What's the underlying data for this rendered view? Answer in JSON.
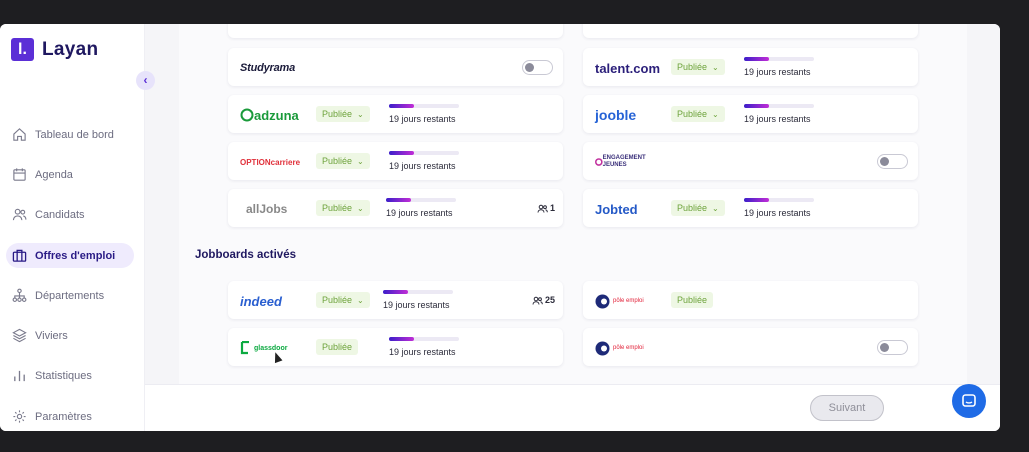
{
  "app": {
    "logo_letter": "l.",
    "name": "Layan",
    "collapse_icon": "chevron-left-icon"
  },
  "sidebar": {
    "items": [
      {
        "label": "Tableau de bord",
        "icon": "home-icon",
        "active": false
      },
      {
        "label": "Agenda",
        "icon": "calendar-icon",
        "active": false
      },
      {
        "label": "Candidats",
        "icon": "users-icon",
        "active": false
      },
      {
        "label": "Offres d'emploi",
        "icon": "briefcase-icon",
        "active": true
      },
      {
        "label": "Départements",
        "icon": "org-chart-icon",
        "active": false
      },
      {
        "label": "Viviers",
        "icon": "layers-icon",
        "active": false
      },
      {
        "label": "Statistiques",
        "icon": "bar-chart-icon",
        "active": false
      },
      {
        "label": "Paramètres",
        "icon": "gear-icon",
        "active": false
      }
    ]
  },
  "boards": {
    "studyrama": {
      "name": "Studyrama",
      "enabled": false
    },
    "talent": {
      "name": "talent.com",
      "status": "Publiée",
      "remaining": "19 jours restants",
      "progress": 0.35
    },
    "adzuna": {
      "name": "adzuna",
      "status": "Publiée",
      "remaining": "19 jours restants",
      "progress": 0.35
    },
    "jooble": {
      "name": "jooble",
      "status": "Publiée",
      "remaining": "19 jours restants",
      "progress": 0.35
    },
    "optioncarriere": {
      "name": "OPTIONcarriere",
      "status": "Publiée",
      "remaining": "19 jours restants",
      "progress": 0.35
    },
    "engagement": {
      "name": "ENGAGEMENT JEUNES",
      "enabled": false
    },
    "alljobs": {
      "name": "allJobs",
      "status": "Publiée",
      "remaining": "19 jours restants",
      "progress": 0.35,
      "count": "1"
    },
    "jobted": {
      "name": "Jobted",
      "status": "Publiée",
      "remaining": "19 jours restants",
      "progress": 0.35
    }
  },
  "activated": {
    "title": "Jobboards activés",
    "indeed": {
      "name": "indeed",
      "status": "Publiée",
      "remaining": "19 jours restants",
      "progress": 0.35,
      "count": "25"
    },
    "pole1": {
      "name": "pôle emploi",
      "status": "Publiée"
    },
    "glassdoor": {
      "name": "glassdoor",
      "status": "Publiée",
      "remaining": "19 jours restants",
      "progress": 0.35
    },
    "pole2": {
      "name": "pôle emploi",
      "enabled": false
    }
  },
  "footer": {
    "next_label": "Suivant"
  },
  "colors": {
    "brand": "#5b2fd6",
    "status_bg": "#eef7e4",
    "status_text": "#6ea33c",
    "chat": "#1f6be6"
  }
}
